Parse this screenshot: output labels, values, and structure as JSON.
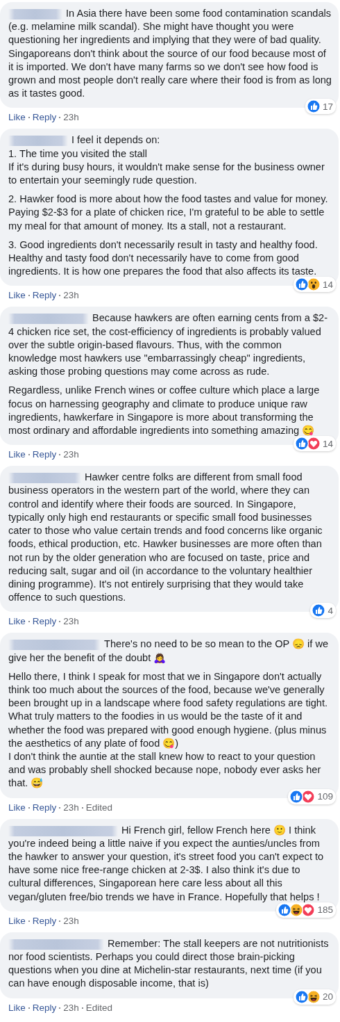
{
  "comments": [
    {
      "paragraphs": [
        "In Asia there have been some food contamination scandals (e.g. melamine milk scandal). She might have thought you were questioning her ingredients and implying that they were of bad quality. Singaporeans don't think about the source of our food because most of it is imported. We don't have many farms so we don't see how food is grown and most people don't really care where their food is from as long as it tastes good."
      ],
      "actions": [
        "Like",
        "Reply",
        "23h"
      ],
      "reactions": [
        {
          "kind": "like"
        }
      ],
      "reaction_count": "17"
    },
    {
      "paragraphs": [
        "I feel it depends on:\n1. The time you visited the stall\nIf it's during busy hours, it wouldn't make sense for the business owner to entertain your seemingly rude question.",
        "2. Hawker food is more about how the food tastes and value for money. Paying $2-$3 for a plate of chicken rice, I'm grateful to be able to settle my meal for that amount of money. Its a stall, not a restaurant.",
        "3. Good ingredients don't necessarily result in tasty and healthy food. Healthy and tasty food don't necessarily have to come from good ingredients. It is how one prepares the food that also affects its taste."
      ],
      "actions": [
        "Like",
        "Reply",
        "23h"
      ],
      "reactions": [
        {
          "kind": "like"
        },
        {
          "kind": "wow"
        }
      ],
      "reaction_count": "14"
    },
    {
      "paragraphs": [
        "Because hawkers are often earning cents from a $2-4 chicken rice set, the cost-efficiency of ingredients is probably valued over the subtle origin-based flavours. Thus, with the common knowledge most hawkers use \"embarrassingly cheap\" ingredients, asking those probing questions may come across as rude.",
        "Regardless, unlike French wines or coffee culture which place a large focus on harnessing geography and climate to produce unique raw ingredients, hawkerfare in Singapore is more about transforming the most ordinary and affordable ingredients into something amazing 😋"
      ],
      "actions": [
        "Like",
        "Reply",
        "23h"
      ],
      "reactions": [
        {
          "kind": "like"
        },
        {
          "kind": "love"
        }
      ],
      "reaction_count": "14"
    },
    {
      "paragraphs": [
        "Hawker centre folks are different from small food business operators in the western part of the world, where they can control and identify where their foods are sourced. In Singapore, typically only high end restaurants or specific small food businesses cater to those who value certain trends and food concerns like organic foods, ethical production, etc. Hawker businesses are more often than not run by the older generation who are focused on taste, price and reducing salt, sugar and oil (in accordance to the voluntary healthier dining programme). It's not entirely surprising that they would take offence to such questions."
      ],
      "actions": [
        "Like",
        "Reply",
        "23h"
      ],
      "reactions": [
        {
          "kind": "like"
        }
      ],
      "reaction_count": "4"
    },
    {
      "paragraphs": [
        "There's no need to be so mean to the OP 😞 if we give her the benefit of the doubt 🙇‍♀️",
        "Hello there, I think I speak for most that we in Singapore don't actually think too much about the sources of the food, because we've generally been brought up in a landscape where food safety regulations are tight. What truly matters to the foodies in us would be the taste of it and whether the food was prepared with good enough hygiene. (plus minus the aesthetics of any plate of food 😋)\nI don't think the auntie at the stall knew how to react to your question and was probably shell shocked because nope, nobody ever asks her that. 😅"
      ],
      "actions": [
        "Like",
        "Reply",
        "23h",
        "Edited"
      ],
      "reactions": [
        {
          "kind": "like"
        },
        {
          "kind": "love"
        }
      ],
      "reaction_count": "109"
    },
    {
      "paragraphs": [
        "Hi French girl, fellow French here 🙂 I think you're indeed being a little naive if you expect the aunties/uncles from the hawker to answer your question, it's street food you can't expect to have some nice free-range chicken at 2-3$. I also think it's due to cultural differences, Singaporean here care less about all this vegan/gluten free/bio trends we have in France. Hopefully that helps !"
      ],
      "actions": [
        "Like",
        "Reply",
        "23h"
      ],
      "reactions": [
        {
          "kind": "like"
        },
        {
          "kind": "haha"
        },
        {
          "kind": "love"
        }
      ],
      "reaction_count": "185"
    },
    {
      "paragraphs": [
        "Remember: The stall keepers are not nutritionists nor food scientists. Perhaps you could direct those brain-picking questions when you dine at Michelin-star restaurants, next time (if you can have enough disposable income, that is)"
      ],
      "actions": [
        "Like",
        "Reply",
        "23h",
        "Edited"
      ],
      "reactions": [
        {
          "kind": "like"
        },
        {
          "kind": "haha"
        }
      ],
      "reaction_count": "20"
    }
  ]
}
